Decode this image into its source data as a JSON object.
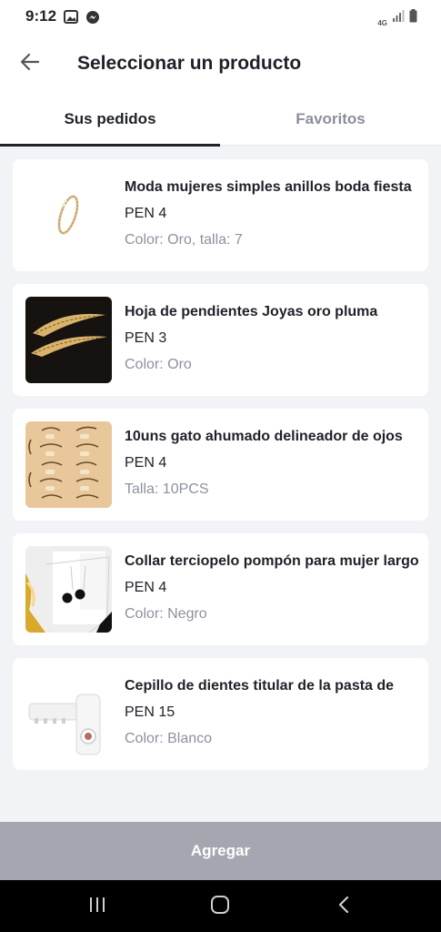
{
  "status_bar": {
    "time": "9:12",
    "network": "4G",
    "icons": [
      "gallery-icon",
      "messenger-icon",
      "signal-icon",
      "battery-icon"
    ]
  },
  "header": {
    "title": "Seleccionar un producto",
    "back_icon": "arrow-left-icon"
  },
  "tabs": [
    {
      "label": "Sus pedidos",
      "active": true
    },
    {
      "label": "Favoritos",
      "active": false
    }
  ],
  "products": [
    {
      "title": "Moda mujeres simples anillos boda fiesta",
      "price": "PEN 4",
      "variant": "Color: Oro, talla: 7",
      "image": "gold-ring-image"
    },
    {
      "title": "Hoja de pendientes Joyas oro pluma",
      "price": "PEN 3",
      "variant": "Color: Oro",
      "image": "feather-earrings-image"
    },
    {
      "title": "10uns gato ahumado delineador de ojos",
      "price": "PEN 4",
      "variant": "Talla: 10PCS",
      "image": "eyeliner-stencils-image"
    },
    {
      "title": "Collar terciopelo pompón para mujer largo",
      "price": "PEN 4",
      "variant": "Color: Negro",
      "image": "pompom-necklace-image"
    },
    {
      "title": "Cepillo de dientes titular de la pasta de",
      "price": "PEN 15",
      "variant": "Color: Blanco",
      "image": "toothpaste-dispenser-image"
    }
  ],
  "footer": {
    "add_label": "Agregar"
  },
  "system_nav": {
    "icons": [
      "recent-apps-icon",
      "home-icon",
      "back-icon"
    ]
  },
  "colors": {
    "background": "#f2f3f7",
    "card": "#ffffff",
    "text_primary": "#1f2129",
    "text_secondary": "#8d91a0",
    "button_disabled": "#a5a7b0",
    "nav_bar": "#000000"
  }
}
